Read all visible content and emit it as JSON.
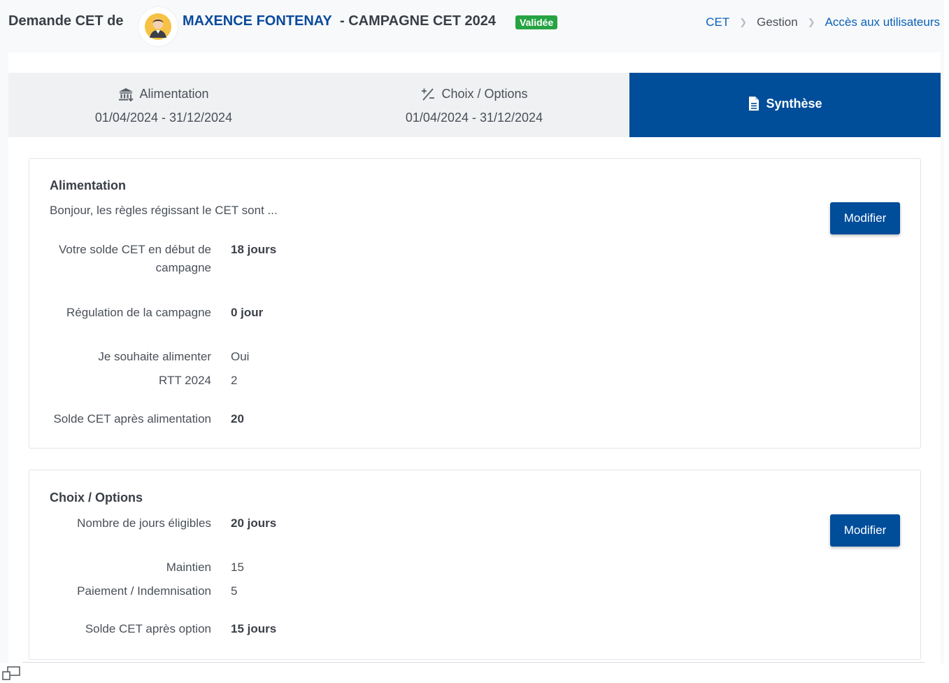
{
  "header": {
    "title_prefix": "Demande CET de",
    "user_name": "MAXENCE FONTENAY",
    "campaign": "- CAMPAGNE CET 2024",
    "status_badge": "Validée",
    "breadcrumb": [
      "CET",
      "Gestion",
      "Accès aux utilisateurs"
    ]
  },
  "tabs": [
    {
      "label": "Alimentation",
      "dates": "01/04/2024 - 31/12/2024",
      "icon": "bank-icon",
      "active": false
    },
    {
      "label": "Choix / Options",
      "dates": "01/04/2024 - 31/12/2024",
      "icon": "plus-minus-icon",
      "active": false
    },
    {
      "label": "Synthèse",
      "dates": "",
      "icon": "document-icon",
      "active": true
    }
  ],
  "alimentation": {
    "title": "Alimentation",
    "description": "Bonjour, les règles régissant le CET sont ...",
    "modify_label": "Modifier",
    "rows": {
      "solde_debut_label": "Votre solde CET en début de campagne",
      "solde_debut_value": "18 jours",
      "regulation_label": "Régulation de la campagne",
      "regulation_value": "0 jour",
      "souhaite_label": "Je souhaite alimenter",
      "souhaite_value": "Oui",
      "rtt_label": "RTT 2024",
      "rtt_value": "2",
      "solde_apres_label": "Solde CET après alimentation",
      "solde_apres_value": "20"
    }
  },
  "choix": {
    "title": "Choix / Options",
    "modify_label": "Modifier",
    "rows": {
      "eligibles_label": "Nombre de jours éligibles",
      "eligibles_value": "20 jours",
      "maintien_label": "Maintien",
      "maintien_value": "15",
      "paiement_label": "Paiement / Indemnisation",
      "paiement_value": "5",
      "solde_label": "Solde CET après option",
      "solde_value": "15 jours"
    }
  },
  "colors": {
    "primary": "#004d9a",
    "link": "#0a60b8",
    "success": "#27a343"
  }
}
